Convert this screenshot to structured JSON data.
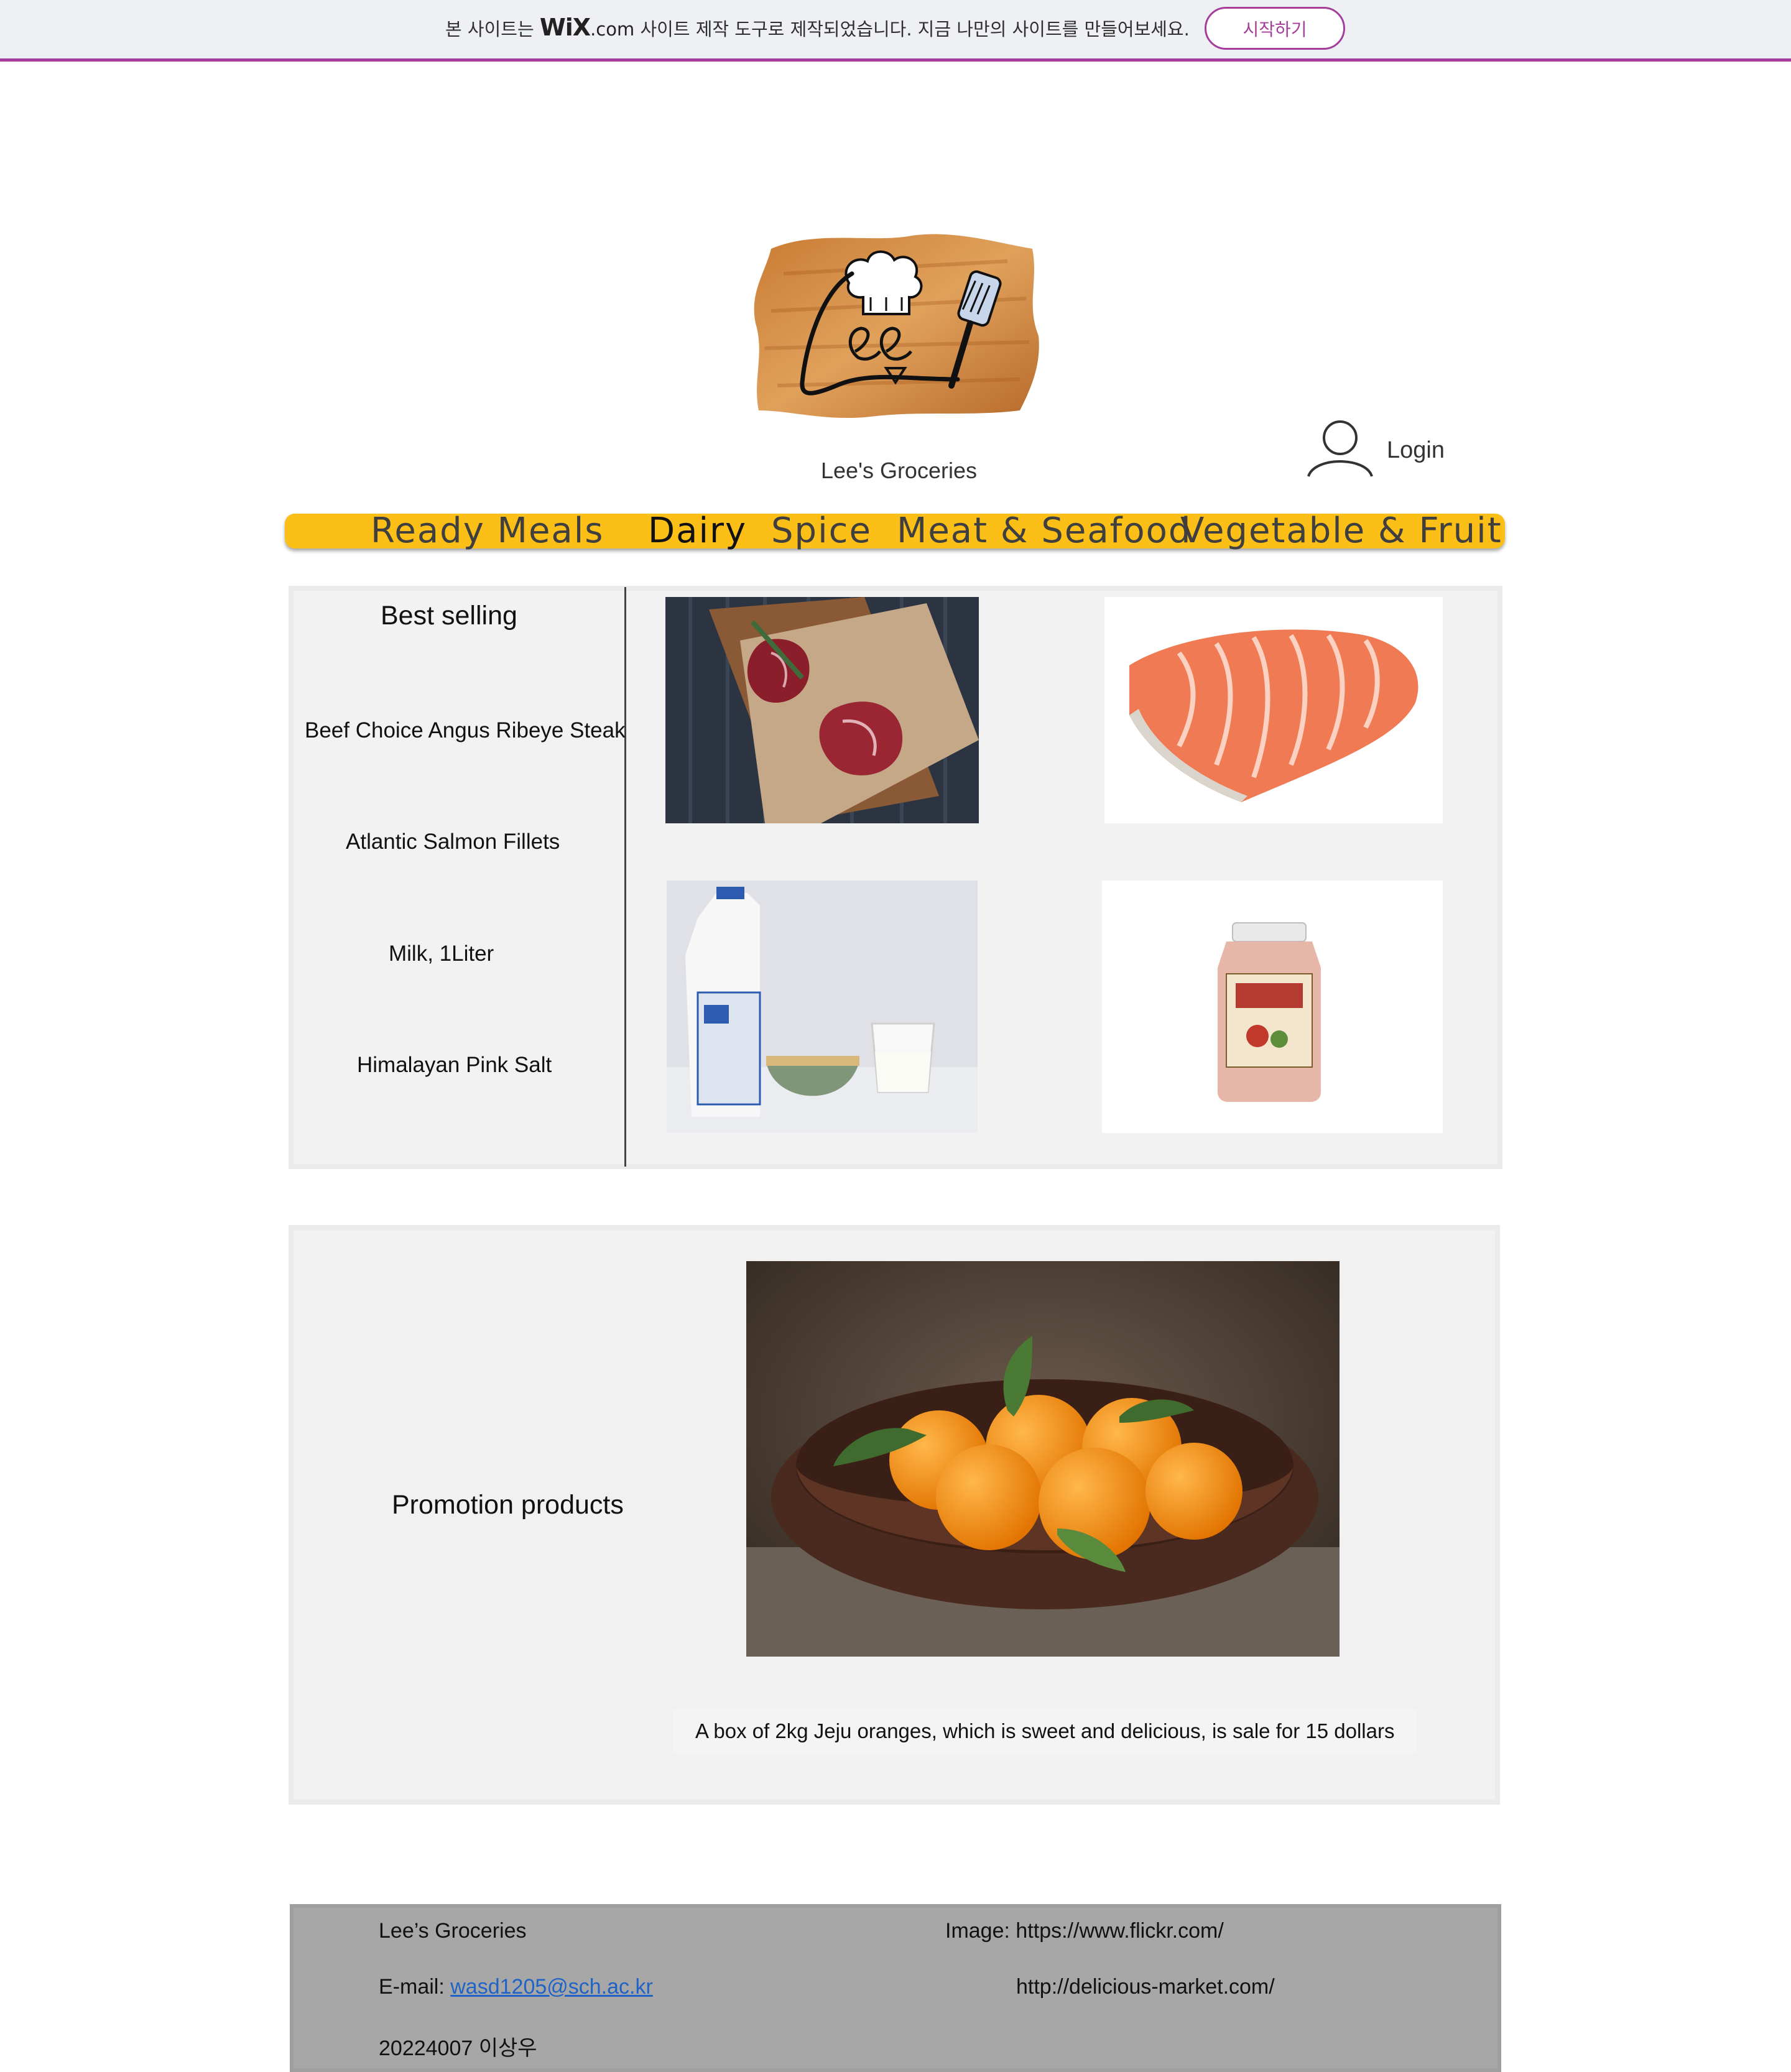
{
  "banner": {
    "text_before": "본 사이트는",
    "logo_wix": "WiX",
    "logo_com": ".com",
    "text_after": "사이트 제작 도구로 제작되었습니다. 지금 나만의 사이트를 만들어보세요.",
    "start_button": "시작하기",
    "accent_color": "#a43d9b"
  },
  "header": {
    "site_title": "Lee's Groceries",
    "login_label": "Login",
    "logo_icon": "chef-hat-spatula-logo"
  },
  "nav": {
    "color": "#fbbf17",
    "items": [
      "Ready Meals",
      "Dairy",
      "Spice",
      "Meat & Seafood",
      "Vegetable & Fruit"
    ]
  },
  "best_selling": {
    "title": "Best selling",
    "items": [
      "Beef Choice Angus Ribeye Steak",
      "Atlantic Salmon Fillets",
      "Milk, 1Liter",
      "Himalayan Pink Salt"
    ]
  },
  "promotion": {
    "title": "Promotion products",
    "description": "A box of 2kg Jeju oranges, which is sweet and delicious, is sale for 15 dollars"
  },
  "footer": {
    "name": "Lee’s Groceries",
    "email_label": "E-mail:",
    "email": "wasd1205@sch.ac.kr",
    "id_line": "20224007  이상우",
    "image_credit": "Image: https://www.flickr.com/",
    "image_credit_url2": "http://delicious-market.com/"
  }
}
